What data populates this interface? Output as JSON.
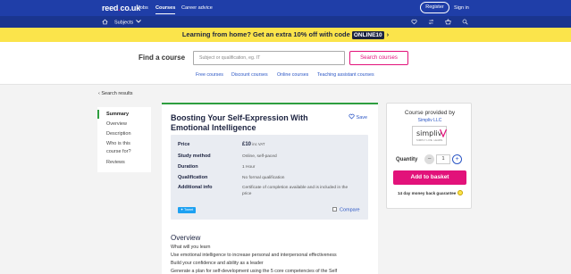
{
  "topnav": {
    "logo_main": "reed",
    "logo_dot": ".",
    "logo_tld": "co.uk",
    "links": [
      "Jobs",
      "Courses",
      "Career advice"
    ],
    "active_link": "Courses",
    "register_label": "Register",
    "signin_label": "Sign in"
  },
  "subnav": {
    "home_icon": "home-icon",
    "subjects_label": "Subjects",
    "icons": [
      "heart-icon",
      "compare-icon",
      "basket-icon",
      "search-icon"
    ]
  },
  "promo": {
    "text": "Learning from home? Get an extra 10% off with code",
    "code": "ONLINE10",
    "chevron": "›"
  },
  "find": {
    "title": "Find a course",
    "search_placeholder": "Subject or qualification, eg. IT",
    "search_button": "Search courses",
    "quick_links": [
      "Free courses",
      "Discount courses",
      "Online courses",
      "Teaching assistant courses"
    ]
  },
  "back_link": "Search results",
  "sidenav": {
    "items": [
      {
        "label": "Summary"
      },
      {
        "label": "Overview"
      },
      {
        "label": "Description"
      },
      {
        "label": "Who is this"
      },
      {
        "label": "course for?"
      },
      {
        "label": "Reviews"
      }
    ]
  },
  "course": {
    "title": "Boosting Your Self-Expression With Emotional Intelligence",
    "save_label": "Save",
    "details": {
      "price_label": "Price",
      "price_value": "£10",
      "price_note": "inc VAT",
      "study_label": "Study method",
      "study_value": "Online, self-paced",
      "duration_label": "Duration",
      "duration_value": "1 Hour",
      "qualification_label": "Qualification",
      "qualification_value": "No formal qualification",
      "additional_label": "Additional info",
      "additional_value_1": "Certificate of completion available and is included in the",
      "additional_value_2": "price"
    },
    "tweet_label": "Tweet",
    "compare_label": "Compare",
    "overview_title": "Overview",
    "overview_lines": [
      "What will you learn",
      "Use emotional intelligence to increase personal and interpersonal effectiveness",
      "Build your confidence and ability as a leader",
      "Generate a plan for self-development using the 5 core competencies of the Self"
    ]
  },
  "provider": {
    "title": "Course provided by",
    "name": "Simpliv LLC",
    "logo_word": "simpliv",
    "logo_tagline": "SIMPLY LIVE. LEARN.",
    "quantity_label": "Quantity",
    "quantity_value": "1",
    "minus": "−",
    "plus": "+",
    "add_label": "Add to basket",
    "guarantee": "14 day money back guarantee"
  },
  "colors": {
    "brand_blue": "#1f3ea8",
    "brand_pink": "#e2127a",
    "promo_yellow": "#fbe44b",
    "accent_green": "#2e9e3f"
  }
}
